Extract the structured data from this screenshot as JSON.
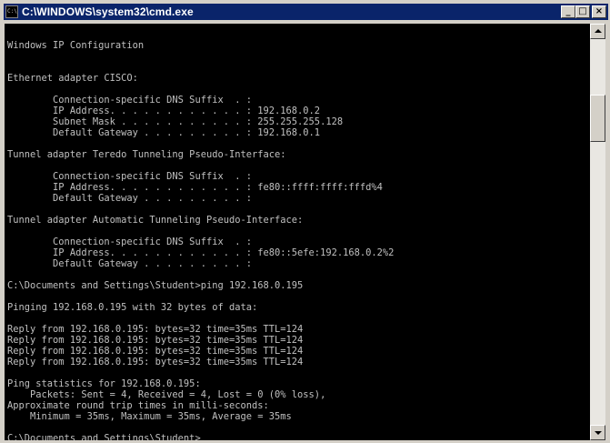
{
  "window": {
    "title": "C:\\WINDOWS\\system32\\cmd.exe",
    "minimize_glyph": "_",
    "maximize_glyph": "□",
    "close_glyph": "×"
  },
  "console": {
    "lines": [
      "",
      "Windows IP Configuration",
      "",
      "",
      "Ethernet adapter CISCO:",
      "",
      "        Connection-specific DNS Suffix  . :",
      "        IP Address. . . . . . . . . . . . : 192.168.0.2",
      "        Subnet Mask . . . . . . . . . . . : 255.255.255.128",
      "        Default Gateway . . . . . . . . . : 192.168.0.1",
      "",
      "Tunnel adapter Teredo Tunneling Pseudo-Interface:",
      "",
      "        Connection-specific DNS Suffix  . :",
      "        IP Address. . . . . . . . . . . . : fe80::ffff:ffff:fffd%4",
      "        Default Gateway . . . . . . . . . :",
      "",
      "Tunnel adapter Automatic Tunneling Pseudo-Interface:",
      "",
      "        Connection-specific DNS Suffix  . :",
      "        IP Address. . . . . . . . . . . . : fe80::5efe:192.168.0.2%2",
      "        Default Gateway . . . . . . . . . :",
      "",
      "C:\\Documents and Settings\\Student>ping 192.168.0.195",
      "",
      "Pinging 192.168.0.195 with 32 bytes of data:",
      "",
      "Reply from 192.168.0.195: bytes=32 time=35ms TTL=124",
      "Reply from 192.168.0.195: bytes=32 time=35ms TTL=124",
      "Reply from 192.168.0.195: bytes=32 time=35ms TTL=124",
      "Reply from 192.168.0.195: bytes=32 time=35ms TTL=124",
      "",
      "Ping statistics for 192.168.0.195:",
      "    Packets: Sent = 4, Received = 4, Lost = 0 (0% loss),",
      "Approximate round trip times in milli-seconds:",
      "    Minimum = 35ms, Maximum = 35ms, Average = 35ms",
      "",
      "C:\\Documents and Settings\\Student>"
    ]
  },
  "colors": {
    "title_bar": "#0a246a",
    "console_bg": "#000000",
    "console_text": "#c0c0c0"
  },
  "icons": {
    "window_icon": "cmd-icon",
    "scroll_up": "arrow-up-icon",
    "scroll_down": "arrow-down-icon"
  }
}
